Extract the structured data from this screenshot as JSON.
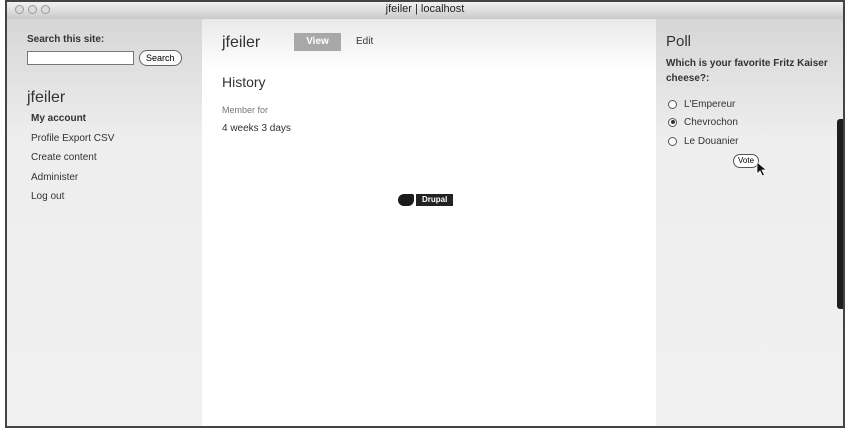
{
  "window": {
    "title": "jfeiler | localhost"
  },
  "left": {
    "search_label": "Search this site:",
    "search_value": "",
    "search_button": "Search",
    "user_heading": "jfeiler",
    "nav": [
      "My account",
      "Profile Export CSV",
      "Create content",
      "Administer",
      "Log out"
    ]
  },
  "main": {
    "title": "jfeiler",
    "tabs": {
      "view": "View",
      "edit": "Edit"
    },
    "history_heading": "History",
    "member_for_label": "Member for",
    "member_for_value": "4 weeks 3 days",
    "drupal_badge": "Drupal"
  },
  "poll": {
    "heading": "Poll",
    "question": "Which is your favorite Fritz Kaiser cheese?:",
    "options": [
      "L'Empereur",
      "Chevrochon",
      "Le Douanier"
    ],
    "selected_index": 1,
    "vote_button": "Vote"
  },
  "icons": {
    "window_buttons": [
      "close-icon",
      "minimize-icon",
      "zoom-icon"
    ],
    "drupal": "drupal-drop-icon",
    "cursor": "pointer-cursor-icon"
  }
}
